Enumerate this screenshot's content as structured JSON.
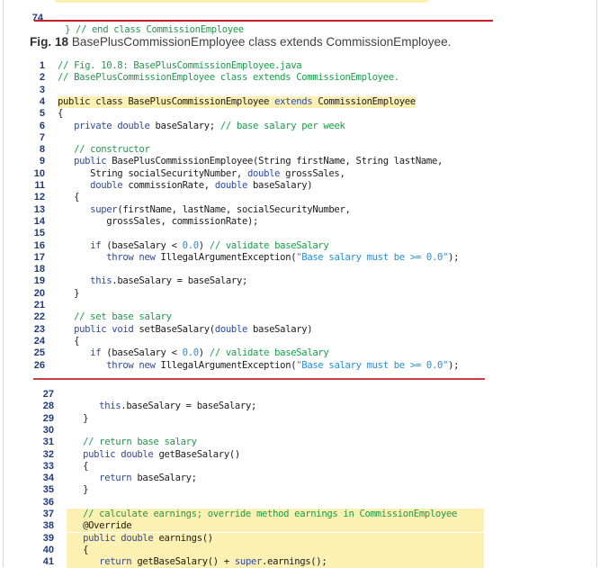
{
  "top_snippet": {
    "line_number": "74",
    "text": "} // end class CommissionEmployee"
  },
  "caption": {
    "label": "Fig. 18",
    "text": " BasePlusCommissionEmployee class extends CommissionEmployee."
  },
  "code_block_1": [
    {
      "n": "1",
      "segments": [
        {
          "t": "// Fig. 10.8: BasePlusCommissionEmployee.java",
          "c": "cm"
        }
      ]
    },
    {
      "n": "2",
      "segments": [
        {
          "t": "// BasePlusCommissionEmployee class extends CommissionEmployee.",
          "c": "cm"
        }
      ]
    },
    {
      "n": "3",
      "segments": []
    },
    {
      "n": "4",
      "hl": true,
      "segments": [
        {
          "t": "public class BasePlusCommissionEmployee ",
          "c": ""
        },
        {
          "t": "extends",
          "c": "kw"
        },
        {
          "t": " CommissionEmployee",
          "c": ""
        }
      ]
    },
    {
      "n": "5",
      "segments": [
        {
          "t": "{",
          "c": ""
        }
      ]
    },
    {
      "n": "6",
      "segments": [
        {
          "t": "   ",
          "c": ""
        },
        {
          "t": "private double",
          "c": "kw"
        },
        {
          "t": " baseSalary; ",
          "c": ""
        },
        {
          "t": "// base salary per week",
          "c": "cm"
        }
      ]
    },
    {
      "n": "7",
      "segments": []
    },
    {
      "n": "8",
      "segments": [
        {
          "t": "   ",
          "c": ""
        },
        {
          "t": "// constructor",
          "c": "cm"
        }
      ]
    },
    {
      "n": "9",
      "segments": [
        {
          "t": "   ",
          "c": ""
        },
        {
          "t": "public",
          "c": "kw"
        },
        {
          "t": " BasePlusCommissionEmployee(String firstName, String lastName,",
          "c": ""
        }
      ]
    },
    {
      "n": "10",
      "segments": [
        {
          "t": "      String socialSecurityNumber, ",
          "c": ""
        },
        {
          "t": "double",
          "c": "kw"
        },
        {
          "t": " grossSales,",
          "c": ""
        }
      ]
    },
    {
      "n": "11",
      "segments": [
        {
          "t": "      ",
          "c": ""
        },
        {
          "t": "double",
          "c": "kw"
        },
        {
          "t": " commissionRate, ",
          "c": ""
        },
        {
          "t": "double",
          "c": "kw"
        },
        {
          "t": " baseSalary)",
          "c": ""
        }
      ]
    },
    {
      "n": "12",
      "segments": [
        {
          "t": "   {",
          "c": ""
        }
      ]
    },
    {
      "n": "13",
      "segments": [
        {
          "t": "      ",
          "c": ""
        },
        {
          "t": "super",
          "c": "kw"
        },
        {
          "t": "(firstName, lastName, socialSecurityNumber,",
          "c": ""
        }
      ]
    },
    {
      "n": "14",
      "segments": [
        {
          "t": "         grossSales, commissionRate);",
          "c": ""
        }
      ]
    },
    {
      "n": "15",
      "segments": []
    },
    {
      "n": "16",
      "segments": [
        {
          "t": "      ",
          "c": ""
        },
        {
          "t": "if",
          "c": "kw"
        },
        {
          "t": " (baseSalary < ",
          "c": ""
        },
        {
          "t": "0.0",
          "c": "nm"
        },
        {
          "t": ") ",
          "c": ""
        },
        {
          "t": "// validate baseSalary",
          "c": "cm"
        }
      ]
    },
    {
      "n": "17",
      "segments": [
        {
          "t": "         ",
          "c": ""
        },
        {
          "t": "throw new",
          "c": "kw"
        },
        {
          "t": " IllegalArgumentException(",
          "c": ""
        },
        {
          "t": "\"Base salary must be >= 0.0\"",
          "c": "st"
        },
        {
          "t": ");",
          "c": ""
        }
      ]
    },
    {
      "n": "18",
      "segments": []
    },
    {
      "n": "19",
      "segments": [
        {
          "t": "      ",
          "c": ""
        },
        {
          "t": "this",
          "c": "kw"
        },
        {
          "t": ".baseSalary = baseSalary;",
          "c": ""
        }
      ]
    },
    {
      "n": "20",
      "segments": [
        {
          "t": "   }",
          "c": ""
        }
      ]
    },
    {
      "n": "21",
      "segments": []
    },
    {
      "n": "22",
      "segments": [
        {
          "t": "   ",
          "c": ""
        },
        {
          "t": "// set base salary",
          "c": "cm"
        }
      ]
    },
    {
      "n": "23",
      "segments": [
        {
          "t": "   ",
          "c": ""
        },
        {
          "t": "public void",
          "c": "kw"
        },
        {
          "t": " setBaseSalary(",
          "c": ""
        },
        {
          "t": "double",
          "c": "kw"
        },
        {
          "t": " baseSalary)",
          "c": ""
        }
      ]
    },
    {
      "n": "24",
      "segments": [
        {
          "t": "   {",
          "c": ""
        }
      ]
    },
    {
      "n": "25",
      "segments": [
        {
          "t": "      ",
          "c": ""
        },
        {
          "t": "if",
          "c": "kw"
        },
        {
          "t": " (baseSalary < ",
          "c": ""
        },
        {
          "t": "0.0",
          "c": "nm"
        },
        {
          "t": ") ",
          "c": ""
        },
        {
          "t": "// validate baseSalary",
          "c": "cm"
        }
      ]
    },
    {
      "n": "26",
      "segments": [
        {
          "t": "         ",
          "c": ""
        },
        {
          "t": "throw new",
          "c": "kw"
        },
        {
          "t": " IllegalArgumentException(",
          "c": ""
        },
        {
          "t": "\"Base salary must be >= 0.0\"",
          "c": "st"
        },
        {
          "t": ");",
          "c": ""
        }
      ]
    }
  ],
  "code_block_2": [
    {
      "n": "27",
      "segments": []
    },
    {
      "n": "28",
      "segments": [
        {
          "t": "      ",
          "c": ""
        },
        {
          "t": "this",
          "c": "kw"
        },
        {
          "t": ".baseSalary = baseSalary;",
          "c": ""
        }
      ]
    },
    {
      "n": "29",
      "segments": [
        {
          "t": "   }",
          "c": ""
        }
      ]
    },
    {
      "n": "30",
      "segments": []
    },
    {
      "n": "31",
      "segments": [
        {
          "t": "   ",
          "c": ""
        },
        {
          "t": "// return base salary",
          "c": "cm"
        }
      ]
    },
    {
      "n": "32",
      "segments": [
        {
          "t": "   ",
          "c": ""
        },
        {
          "t": "public double",
          "c": "kw"
        },
        {
          "t": " getBaseSalary()",
          "c": ""
        }
      ]
    },
    {
      "n": "33",
      "segments": [
        {
          "t": "   {",
          "c": ""
        }
      ]
    },
    {
      "n": "34",
      "segments": [
        {
          "t": "      ",
          "c": ""
        },
        {
          "t": "return",
          "c": "kw"
        },
        {
          "t": " baseSalary;",
          "c": ""
        }
      ]
    },
    {
      "n": "35",
      "segments": [
        {
          "t": "   }",
          "c": ""
        }
      ]
    },
    {
      "n": "36",
      "segments": []
    },
    {
      "n": "37",
      "hl": true,
      "segments": [
        {
          "t": "   ",
          "c": ""
        },
        {
          "t": "// calculate earnings; override method earnings in CommissionEmployee",
          "c": "cm"
        }
      ]
    },
    {
      "n": "38",
      "hl": true,
      "segments": [
        {
          "t": "   @Override",
          "c": ""
        }
      ]
    },
    {
      "n": "39",
      "hl": true,
      "segments": [
        {
          "t": "   ",
          "c": ""
        },
        {
          "t": "public double",
          "c": "kw"
        },
        {
          "t": " earnings()",
          "c": ""
        }
      ]
    },
    {
      "n": "40",
      "hl": true,
      "segments": [
        {
          "t": "   {",
          "c": ""
        }
      ]
    },
    {
      "n": "41",
      "hl": true,
      "segments": [
        {
          "t": "      ",
          "c": ""
        },
        {
          "t": "return",
          "c": "kw"
        },
        {
          "t": " getBaseSalary() + ",
          "c": ""
        },
        {
          "t": "super",
          "c": "kw"
        },
        {
          "t": ".earnings();",
          "c": ""
        }
      ]
    }
  ]
}
